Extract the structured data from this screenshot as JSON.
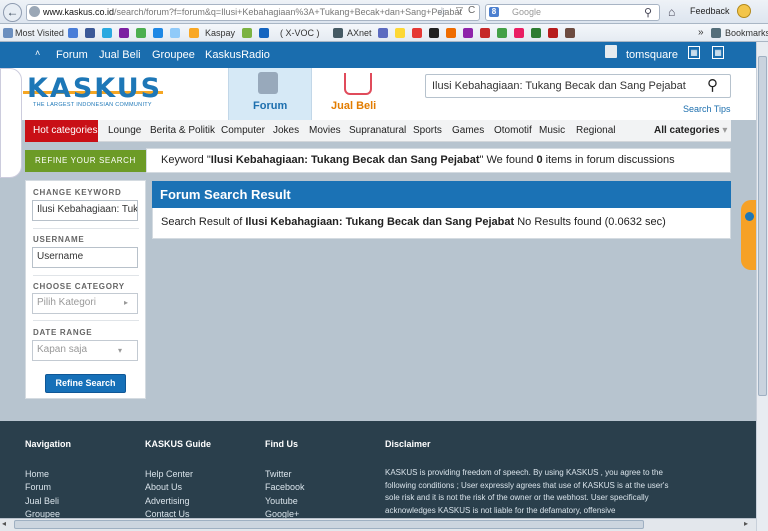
{
  "browser": {
    "url_domain": "www.kaskus.co.id",
    "url_path": "/search/forum?f=forum&q=Ilusi+Kebahagiaan%3A+Tukang+Becak+dan+Sang+Pejabat",
    "search_placeholder": "Google",
    "feedback_label": "Feedback",
    "bookmarks": {
      "most_visited": "Most Visited",
      "kaspay": "Kaspay",
      "xvoc": "( X-VOC )",
      "axnet": "AXnet",
      "more": "»",
      "bookmarks_label": "Bookmarks"
    }
  },
  "topnav": {
    "items": [
      "Forum",
      "Jual Beli",
      "Groupee",
      "KaskusRadio"
    ],
    "username": "tomsquare"
  },
  "header": {
    "logo": "KASKUS",
    "tagline": "THE LARGEST INDONESIAN COMMUNITY",
    "tab_forum": "Forum",
    "tab_jualbeli": "Jual Beli",
    "search_value": "Ilusi Kebahagiaan: Tukang Becak dan Sang Pejabat",
    "search_tips": "Search Tips"
  },
  "categories": {
    "hot": "Hot categories",
    "items": [
      "Lounge",
      "Berita & Politik",
      "Computer",
      "Jokes",
      "Movies",
      "Supranatural",
      "Sports",
      "Games",
      "Otomotif",
      "Music",
      "Regional"
    ],
    "all": "All categories"
  },
  "refine": {
    "header": "REFINE YOUR SEARCH",
    "keyword_prefix": "Keyword \"",
    "keyword": "Ilusi Kebahagiaan: Tukang Becak dan Sang Pejabat",
    "keyword_mid": "\" We found ",
    "count": "0",
    "keyword_suffix": " items in forum discussions",
    "change_keyword_label": "CHANGE KEYWORD",
    "change_keyword_value": "Ilusi Kebahagiaan: Tuk",
    "username_label": "USERNAME",
    "username_placeholder": "Username",
    "category_label": "CHOOSE CATEGORY",
    "category_value": "Pilih Kategori",
    "daterange_label": "DATE RANGE",
    "daterange_value": "Kapan saja",
    "button": "Refine Search"
  },
  "result": {
    "title": "Forum Search Result",
    "prefix": "Search Result of ",
    "query": "Ilusi Kebahagiaan: Tukang Becak dan Sang Pejabat",
    "suffix": " No Results found (0.0632 sec)"
  },
  "footer": {
    "navigation": {
      "title": "Navigation",
      "links": [
        "Home",
        "Forum",
        "Jual Beli",
        "Groupee"
      ]
    },
    "guide": {
      "title": "KASKUS Guide",
      "links": [
        "Help Center",
        "About Us",
        "Advertising",
        "Contact Us"
      ]
    },
    "findus": {
      "title": "Find Us",
      "links": [
        "Twitter",
        "Facebook",
        "Youtube",
        "Google+"
      ]
    },
    "disclaimer": {
      "title": "Disclaimer",
      "text": "KASKUS is providing freedom of speech. By using KASKUS , you agree to the following conditions ; User expressly agrees that use of KASKUS is at the user's sole risk and it is not the risk of the owner or the webhost. User specifically acknowledges KASKUS is not liable for the defamatory, offensive"
    }
  },
  "colors": {
    "brand_blue": "#1b72b5",
    "hot_red": "#c90f16",
    "refine_green": "#6c9b26",
    "footer_bg": "#2a3f4c"
  }
}
